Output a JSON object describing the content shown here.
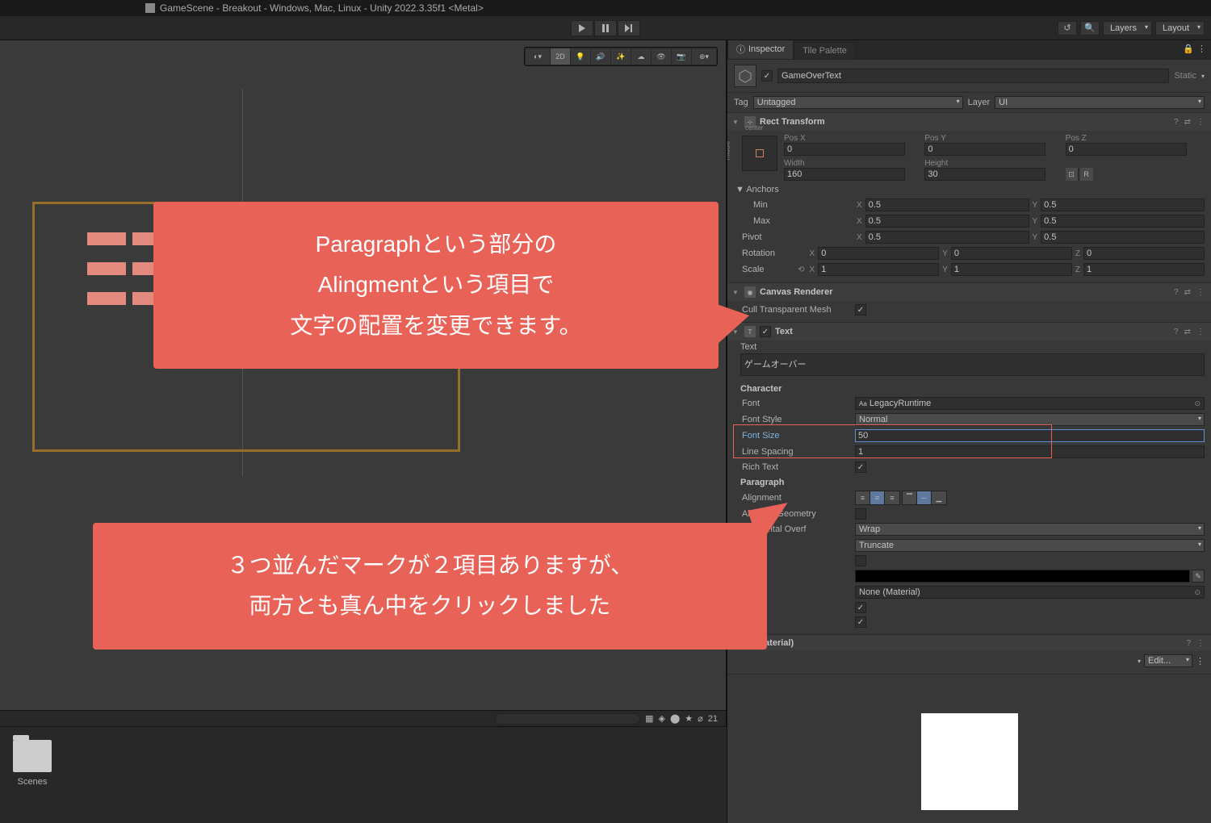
{
  "titlebar": "GameScene - Breakout - Windows, Mac, Linux - Unity 2022.3.35f1 <Metal>",
  "toolbar": {
    "layers": "Layers",
    "layout": "Layout"
  },
  "scene_toolbar": {
    "mode_2d": "2D"
  },
  "assets": {
    "scenes": "Scenes"
  },
  "inspector": {
    "tab_inspector": "Inspector",
    "tab_tile": "Tile Palette",
    "name": "GameOverText",
    "static": "Static",
    "tag_label": "Tag",
    "tag_value": "Untagged",
    "layer_label": "Layer",
    "layer_value": "UI",
    "rect": {
      "title": "Rect Transform",
      "anchor_h": "center",
      "anchor_v": "middle",
      "posx_label": "Pos X",
      "posx": "0",
      "posy_label": "Pos Y",
      "posy": "0",
      "posz_label": "Pos Z",
      "posz": "0",
      "width_label": "Width",
      "width": "160",
      "height_label": "Height",
      "height": "30",
      "anchors": "Anchors",
      "min": "Min",
      "minx": "0.5",
      "miny": "0.5",
      "max": "Max",
      "maxx": "0.5",
      "maxy": "0.5",
      "pivot": "Pivot",
      "pivotx": "0.5",
      "pivoty": "0.5",
      "rotation": "Rotation",
      "rx": "0",
      "ry": "0",
      "rz": "0",
      "scale": "Scale",
      "sx": "1",
      "sy": "1",
      "sz": "1"
    },
    "canvas_renderer": {
      "title": "Canvas Renderer",
      "cull": "Cull Transparent Mesh"
    },
    "text": {
      "title": "Text",
      "text_label": "Text",
      "text_value": "ゲームオーバー",
      "character": "Character",
      "font_label": "Font",
      "font_value": "LegacyRuntime",
      "fontstyle_label": "Font Style",
      "fontstyle_value": "Normal",
      "fontsize_label": "Font Size",
      "fontsize_value": "50",
      "linespacing_label": "Line Spacing",
      "linespacing_value": "1",
      "richtext_label": "Rich Text",
      "paragraph": "Paragraph",
      "alignment_label": "Alignment",
      "alignbygeo_label": "Align By Geometry",
      "horizoverflow_label": "Horizontal Overf",
      "horizoverflow_value": "Wrap",
      "vertoverflow_value": "Truncate",
      "material_none": "None (Material)",
      "material_title": "al (Material)",
      "shader_edit": "Edit..."
    },
    "x": "X",
    "y": "Y",
    "z": "Z"
  },
  "callouts": {
    "c1_l1": "Paragraphという部分の",
    "c1_l2": "Alingmentという項目で",
    "c1_l3": "文字の配置を変更できます。",
    "c2_l1": "３つ並んだマークが２項目ありますが、",
    "c2_l2": "両方とも真ん中をクリックしました"
  },
  "hidden_count": "21"
}
